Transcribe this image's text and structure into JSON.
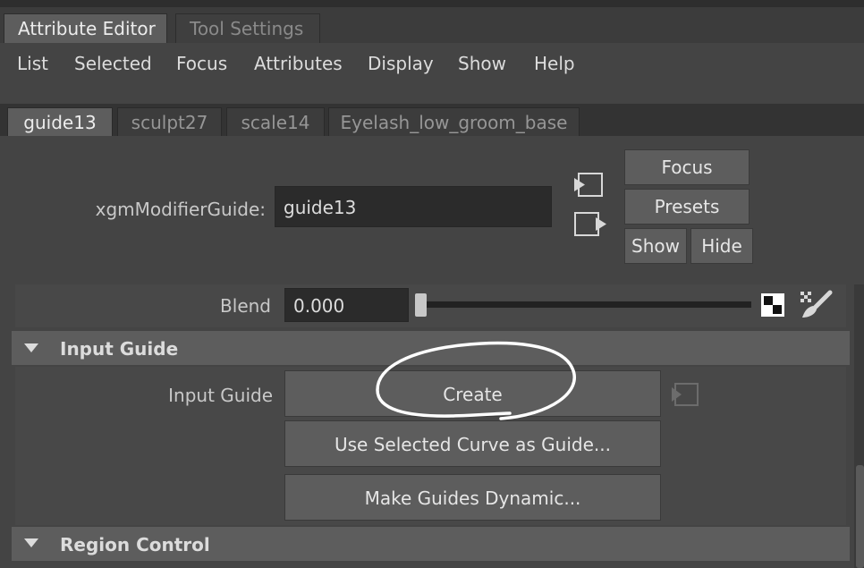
{
  "window": {
    "tabs": [
      {
        "label": "Attribute Editor",
        "active": true
      },
      {
        "label": "Tool Settings",
        "active": false
      }
    ]
  },
  "menubar": {
    "items": [
      "List",
      "Selected",
      "Focus",
      "Attributes",
      "Display",
      "Show",
      "Help"
    ]
  },
  "node_tabs": [
    {
      "label": "guide13",
      "active": true
    },
    {
      "label": "sculpt27",
      "active": false
    },
    {
      "label": "scale14",
      "active": false
    },
    {
      "label": "Eyelash_low_groom_base",
      "active": false
    }
  ],
  "node": {
    "type_label": "xgmModifierGuide:",
    "name_value": "guide13",
    "buttons": {
      "focus": "Focus",
      "presets": "Presets",
      "show": "Show",
      "hide": "Hide"
    },
    "icons": {
      "input_connection": "input-connection-icon",
      "output_connection": "output-connection-icon"
    }
  },
  "blend": {
    "label": "Blend",
    "value": "0.000",
    "slider_fraction": 0.0,
    "icons": {
      "map": "checker-map-icon",
      "paint": "paint-brush-icon"
    }
  },
  "input_guide_section": {
    "title": "Input Guide",
    "expanded": true,
    "row_label": "Input Guide",
    "buttons": {
      "create": "Create",
      "use_selected": "Use Selected Curve as Guide...",
      "make_dynamic": "Make Guides Dynamic..."
    },
    "annotation": "hand-drawn-circle-around-create"
  },
  "region_control_section": {
    "title": "Region Control",
    "expanded": true
  },
  "colors": {
    "background": "#444444",
    "button": "#5d5d5d",
    "field": "#2b2b2b",
    "annotation_stroke": "#ffffff"
  }
}
